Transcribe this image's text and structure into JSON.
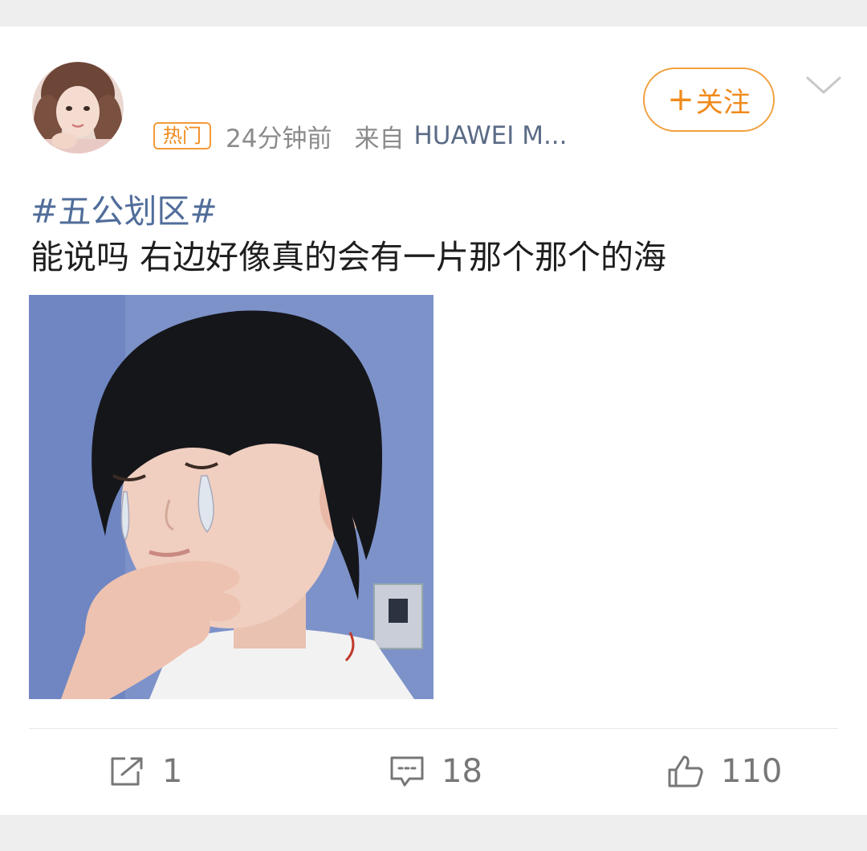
{
  "post": {
    "hot_badge": "热门",
    "time": "24分钟前",
    "source_prefix": "来自",
    "source": "HUAWEI M...",
    "follow_label": "关注",
    "topic": "#五公划区#",
    "text": "能说吗 右边好像真的会有一片那个那个的海"
  },
  "actions": {
    "repost_count": "1",
    "comment_count": "18",
    "like_count": "110"
  },
  "icons": {
    "avatar": "avatar",
    "more": "chevron-down-icon",
    "repost": "share-icon",
    "comment": "comment-icon",
    "like": "thumbs-up-icon"
  },
  "colors": {
    "accent": "#f08a1c",
    "topic": "#506d9a",
    "muted": "#8b8b8b"
  }
}
